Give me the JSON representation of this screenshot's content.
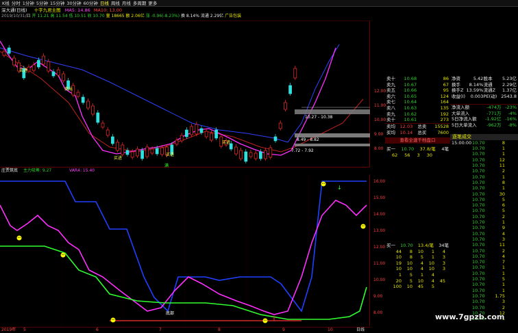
{
  "menu": {
    "items": [
      {
        "label": "K线",
        "active": false
      },
      {
        "label": "分时",
        "active": false
      },
      {
        "label": "1分钟",
        "active": false
      },
      {
        "label": "5分钟",
        "active": false
      },
      {
        "label": "15分钟",
        "active": false
      },
      {
        "label": "30分钟",
        "active": false
      },
      {
        "label": "60分钟",
        "active": false
      },
      {
        "label": "日线",
        "active": true
      },
      {
        "label": "周线",
        "active": false
      },
      {
        "label": "月线",
        "active": false
      },
      {
        "label": "多周期",
        "active": false
      },
      {
        "label": "更多",
        "active": false
      }
    ]
  },
  "stock": {
    "name": "深大通(日线)",
    "indicator": "十字九君主图",
    "ma5": "MA5: 14.86",
    "ma10": "MA10: 13.00"
  },
  "info_line": {
    "date": "2019/10/31/四",
    "open": "开 11.21",
    "high": "高 11.54",
    "low": "低 10.51",
    "close": "收 10.70",
    "vol": "量 18665",
    "amount": "额 2.06亿",
    "change": "涨 -0.96(-8.23%)",
    "turnover": "换 8.14%",
    "float": "流通 2.29亿",
    "ad": "广告包装"
  },
  "main_chart": {
    "price_labels": [
      "12.00",
      "11.00",
      "10.00",
      "9.00",
      "8.00"
    ],
    "annotations": {
      "box_high": "10.27 - 10.38",
      "box_mid": "8.49 - 8.82",
      "box_low": "7.72 - 7.92",
      "buy_marks": [
        "买进",
        "买进",
        "买进",
        "买进",
        "买进"
      ],
      "sell_marks": [
        "卖出"
      ],
      "full_mark": "满"
    }
  },
  "sub_chart": {
    "title": "庄贾筑底",
    "param1": "主力吸筹: 9.27",
    "param2": "VAR4: 15.40",
    "price_labels": [
      "16.00",
      "15.00",
      "14.00",
      "13.00",
      "12.00",
      "11.00",
      "10.00",
      "9.00",
      "8.00"
    ],
    "mark_label": "底部",
    "date_labels": [
      "2019年",
      "5",
      "6",
      "7",
      "8",
      "9",
      "10"
    ],
    "axis_name": "日线"
  },
  "order_book": {
    "sells": [
      {
        "name": "卖十",
        "price": "10.68",
        "vol": "86"
      },
      {
        "name": "卖九",
        "price": "10.67",
        "vol": "67"
      },
      {
        "name": "卖五",
        "price": "10.66",
        "vol": "95"
      },
      {
        "name": "卖六",
        "price": "10.65",
        "vol": "124"
      },
      {
        "name": "卖七",
        "price": "10.64",
        "vol": "164"
      },
      {
        "name": "卖八",
        "price": "10.63",
        "vol": "135"
      },
      {
        "name": "卖九",
        "price": "10.62",
        "vol": "192"
      },
      {
        "name": "卖十",
        "price": "10.61",
        "vol": "273"
      }
    ],
    "summary": [
      {
        "name": "卖均",
        "price": "12.03",
        "label": "总卖",
        "vol": "15528"
      },
      {
        "name": "买均",
        "price": "10.14",
        "label": "总买",
        "vol": "7600"
      }
    ],
    "link": "查看全速千档盘口",
    "buy1_header": {
      "name": "买一",
      "price": "10.70",
      "vol": "37.8/笔",
      "count": "4笔"
    },
    "buy1_queue": [
      "62",
      "56",
      "3",
      "30"
    ],
    "buy2_header": {
      "name": "买一",
      "price": "10.70",
      "vol": "13.4/笔",
      "count": "34笔"
    },
    "buy2_queue": [
      [
        "44",
        "8",
        "10",
        "1",
        "4"
      ],
      [
        "10",
        "8",
        "5",
        "1",
        "3"
      ],
      [
        "19",
        "10",
        "4",
        "10",
        "3"
      ],
      [
        "10",
        "10",
        "4",
        "10",
        "3"
      ],
      [
        "1",
        "5",
        "1",
        "4",
        ""
      ],
      [
        "20",
        "5",
        "10",
        "4",
        "45"
      ],
      [
        "100",
        "10",
        "45",
        "5",
        ""
      ]
    ]
  },
  "fundamentals": {
    "rows": [
      {
        "l1": "净资",
        "v1": "5.42",
        "l2": "股本",
        "v2": "5.23亿"
      },
      {
        "l1": "换手",
        "v1": "8.14%",
        "l2": "流通",
        "v2": "2.29亿"
      },
      {
        "l1": "换手Z",
        "v1": "13.59%",
        "l2": "流通Z",
        "v2": "1.37亿"
      },
      {
        "l1": "收益(I)",
        "v1": "0.003",
        "l2": "PE(动)",
        "v2": "2543.8"
      }
    ],
    "flows": [
      {
        "label": "净流入额",
        "val": "-474万",
        "pct": "-23%"
      },
      {
        "label": "大单流入",
        "val": "-771万",
        "pct": "-4%"
      },
      {
        "label": "5日净流入额",
        "val": "-1.92亿",
        "pct": "-16%"
      },
      {
        "label": "5日大单流入",
        "val": "-962万",
        "pct": "-8%"
      }
    ]
  },
  "ticks": {
    "header": "逐笔成交",
    "times": [
      "15:00:00",
      "",
      "",
      "",
      "",
      "",
      "",
      "",
      "",
      "",
      "",
      "",
      "",
      "",
      "",
      "",
      "",
      "",
      "",
      "",
      "",
      "",
      "",
      "",
      "",
      "",
      "",
      "",
      "",
      "",
      "",
      ""
    ],
    "prices": [
      "10.70",
      "10.70",
      "10.70",
      "10.70",
      "10.70",
      "10.70",
      "10.70",
      "10.70",
      "10.70",
      "10.70",
      "10.70",
      "10.70",
      "10.70",
      "10.70",
      "10.70",
      "10.70",
      "10.70",
      "10.70",
      "10.70",
      "10.70",
      "10.70",
      "10.70",
      "10.70",
      "10.70",
      "10.70",
      "10.70",
      "10.70",
      "10.70",
      "10.70",
      "10.70",
      "10.70",
      "10.70"
    ],
    "extra": [
      "8",
      "1",
      "1",
      "12",
      "11",
      "2",
      "1",
      "8",
      "1",
      "30",
      "5",
      "6",
      "5",
      "2",
      "1",
      "9",
      "4",
      "3",
      "11",
      "2",
      "4",
      "7",
      "1",
      "1",
      "5",
      "1",
      "1",
      "1.75",
      "3",
      "2",
      "12",
      "1"
    ]
  },
  "watermark": "www.7gpzb.com"
}
